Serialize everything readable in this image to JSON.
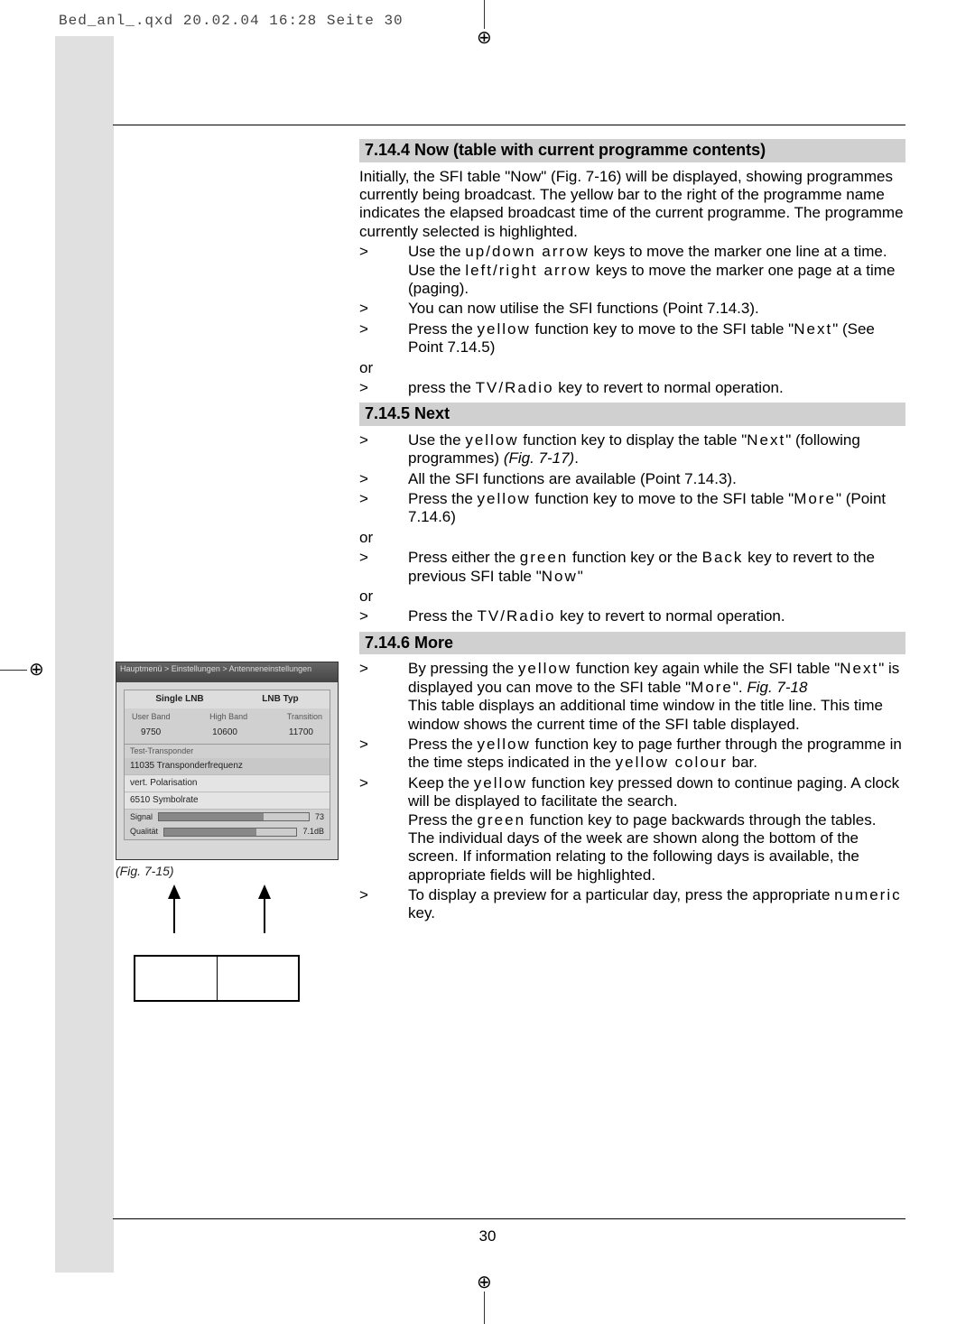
{
  "header": "Bed_anl_.qxd  20.02.04  16:28  Seite 30",
  "page_number": "30",
  "figure": {
    "caption": "(Fig. 7-15)",
    "hdr": [
      "Single LNB",
      "LNB Typ"
    ],
    "rows": [
      "11035 Transponderfrequenz",
      "vert. Polarisation",
      "6510 Symbolrate"
    ],
    "sig": "Signal",
    "sig_val": "73",
    "qual": "Qualität",
    "qual_val": "7.1dB"
  },
  "sections": [
    {
      "heading": "7.14.4 Now (table with current programme contents)",
      "intro": "Initially, the SFI table \"Now\" (Fig. 7-16) will be displayed, showing programmes currently being broadcast. The yellow bar to the right of the programme name indicates the elapsed broadcast time of the current programme. The programme currently selected is highlighted.",
      "items": [
        {
          "gt": ">",
          "html": "Use the <span class='spaced'>up/down arrow</span> keys to move the marker one line at a time. Use the <span class='spaced'>left/right arrow</span> keys to move the marker one page at a time (paging)."
        },
        {
          "gt": ">",
          "html": "You can now utilise the SFI functions (Point 7.14.3)."
        },
        {
          "gt": ">",
          "html": "Press the <span class='spaced'>yellow</span> function key to move to the SFI table \"<span class='spaced'>Next</span>\" (See Point 7.14.5)"
        },
        {
          "or": "or"
        },
        {
          "gt": ">",
          "html": "press the <span class='spaced'>TV/Radio</span> key to revert to normal operation."
        }
      ]
    },
    {
      "heading": "7.14.5 Next",
      "items": [
        {
          "gt": ">",
          "html": "Use the <span class='spaced'>yellow</span> function key to display the table \"<span class='spaced'>Next</span>\" (following programmes) <span class='fig-ref'>(Fig. 7-17)</span>."
        },
        {
          "gt": ">",
          "html": "All the SFI functions are available (Point 7.14.3)."
        },
        {
          "gt": ">",
          "html": "Press the <span class='spaced'>yellow</span> function key to move to the SFI table \"<span class='spaced'>More</span>\" (Point 7.14.6)"
        },
        {
          "or": "or"
        },
        {
          "gt": ">",
          "html": "Press either the <span class='spaced'>green</span> function key or the <span class='spaced'>Back</span> key to revert to the previous SFI table \"<span class='spaced'>Now</span>\""
        },
        {
          "or": "or"
        },
        {
          "gt": ">",
          "html": "Press the <span class='spaced'>TV/Radio</span> key to revert to normal operation."
        }
      ]
    },
    {
      "heading": "7.14.6 More",
      "items": [
        {
          "gt": ">",
          "html": "By pressing the <span class='spaced'>yellow</span> function key again while the SFI table \"<span class='spaced'>Next</span>\" is displayed you can move to the SFI table \"<span class='spaced'>More</span>\". <span class='fig-ref'>Fig. 7-18</span><br>This table displays an additional time window in the title line. This time window shows the current time of the SFI table displayed."
        },
        {
          "gt": ">",
          "html": "Press the <span class='spaced'>yellow</span> function key to page further through the programme in the time steps indicated in the <span class='spaced'>yellow colour</span> bar."
        },
        {
          "gt": ">",
          "html": "Keep the <span class='spaced'>yellow</span> function key pressed down to continue paging. A clock will be displayed to facilitate the search.<br>Press the <span class='spaced'>green</span> function key to page backwards through the tables.<br>The individual days of the week are shown along the bottom of the screen. If information relating to the following days is available, the appropriate fields will be highlighted."
        },
        {
          "gt": ">",
          "html": "To display a preview for a particular day, press the appropriate <span class='spaced'>numeric</span> key."
        }
      ]
    }
  ]
}
